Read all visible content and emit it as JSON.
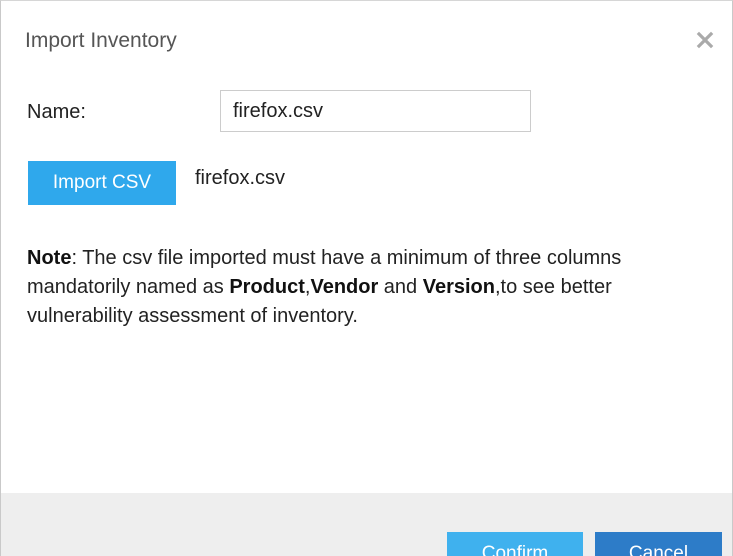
{
  "dialog": {
    "title": "Import Inventory",
    "close_icon": "close-icon"
  },
  "form": {
    "name_label": "Name:",
    "name_value": "firefox.csv"
  },
  "import": {
    "button_label": "Import CSV",
    "selected_file": "firefox.csv"
  },
  "note": {
    "label": "Note",
    "part1": ": The csv file imported must have a minimum of three columns mandatorily named as ",
    "field1": "Product",
    "sep1": ",",
    "field2": "Vendor",
    "part2": " and ",
    "field3": "Version",
    "part3": ",to see better vulnerability assessment of inventory."
  },
  "footer": {
    "confirm_label": "Confirm",
    "cancel_label": "Cancel"
  },
  "colors": {
    "import_button": "#2fa8ec",
    "confirm_button": "#3fb1ee",
    "cancel_button": "#2d7cc8",
    "footer_background": "#eeeeee"
  }
}
